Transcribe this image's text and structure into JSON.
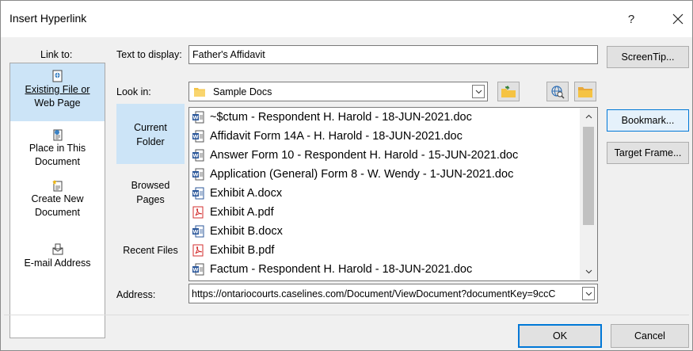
{
  "dialog": {
    "title": "Insert Hyperlink",
    "help": "?",
    "close": "✕"
  },
  "link_to": {
    "label": "Link to:",
    "items": [
      {
        "line1": "Existing File or",
        "line2": "Web Page",
        "selected": true,
        "icon": "existing-file-icon"
      },
      {
        "line1": "Place in This",
        "line2": "Document",
        "selected": false,
        "icon": "place-in-document-icon"
      },
      {
        "line1": "Create New",
        "line2": "Document",
        "selected": false,
        "icon": "new-document-icon"
      },
      {
        "line1": "E-mail Address",
        "line2": "",
        "selected": false,
        "icon": "email-icon"
      }
    ]
  },
  "text_to_display": {
    "label": "Text to display:",
    "value": "Father's Affidavit"
  },
  "screentip_label": "ScreenTip...",
  "look_in": {
    "label": "Look in:",
    "value": "Sample Docs",
    "icon": "folder-icon"
  },
  "toolbar_icons": [
    "up-one-folder-icon",
    "browse-web-icon",
    "browse-file-icon"
  ],
  "sidebar": [
    {
      "line1": "Current",
      "line2": "Folder",
      "selected": true
    },
    {
      "line1": "Browsed",
      "line2": "Pages",
      "selected": false
    },
    {
      "line1": "Recent Files",
      "line2": "",
      "selected": false
    }
  ],
  "files": [
    {
      "name": "~$ctum - Respondent H. Harold - 18-JUN-2021.doc",
      "type": "word-doc"
    },
    {
      "name": "Affidavit Form 14A - H. Harold - 18-JUN-2021.doc",
      "type": "word-doc"
    },
    {
      "name": "Answer Form 10 - Respondent H. Harold - 15-JUN-2021.doc",
      "type": "word-doc"
    },
    {
      "name": "Application (General) Form 8 - W. Wendy - 1-JUN-2021.doc",
      "type": "word-doc"
    },
    {
      "name": "Exhibit A.docx",
      "type": "word-docx"
    },
    {
      "name": "Exhibit A.pdf",
      "type": "pdf"
    },
    {
      "name": "Exhibit B.docx",
      "type": "word-docx"
    },
    {
      "name": "Exhibit B.pdf",
      "type": "pdf"
    },
    {
      "name": "Factum - Respondent H. Harold - 18-JUN-2021.doc",
      "type": "word-doc"
    }
  ],
  "right_buttons": {
    "bookmark": "Bookmark...",
    "target_frame": "Target Frame..."
  },
  "address": {
    "label": "Address:",
    "value": "https://ontariocourts.caselines.com/Document/ViewDocument?documentKey=9ccC"
  },
  "footer": {
    "ok": "OK",
    "cancel": "Cancel"
  },
  "colors": {
    "selection": "#cce4f7",
    "accent": "#0078d7",
    "pdf": "#d32f2f",
    "word": "#2b579a"
  }
}
